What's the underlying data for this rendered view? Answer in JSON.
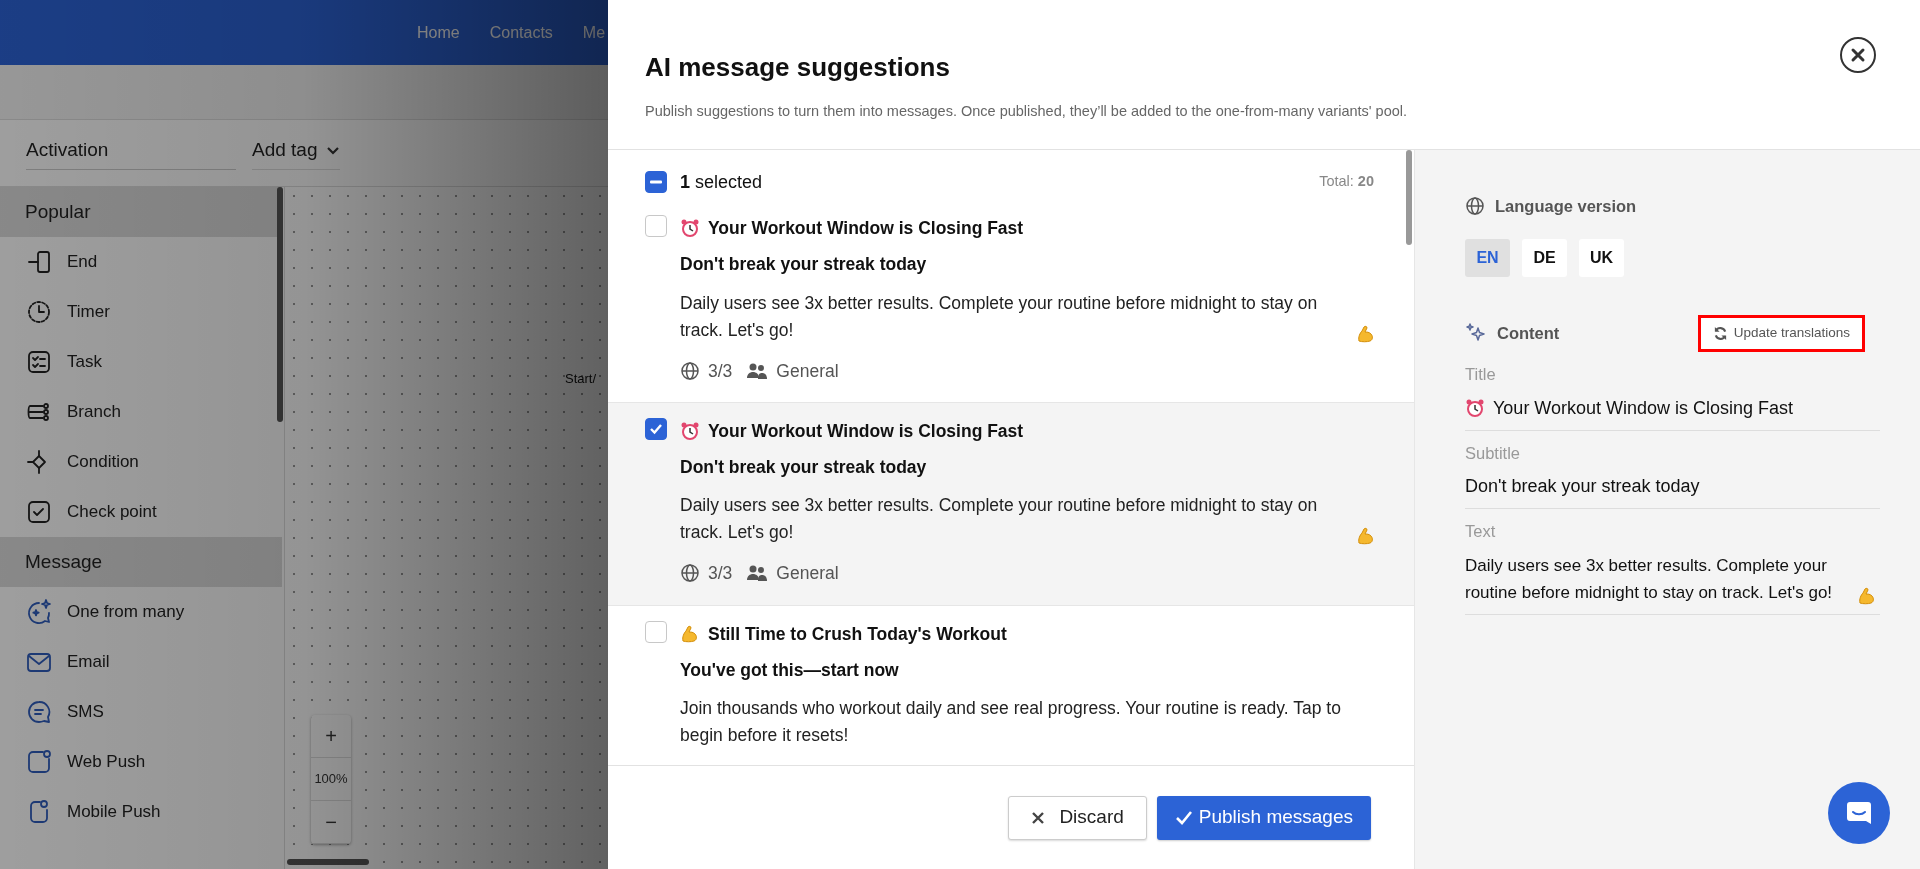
{
  "nav_links": [
    "Home",
    "Contacts",
    "Me"
  ],
  "toolbar": {
    "activation": "Activation",
    "add_tag": "Add tag"
  },
  "sidebar": [
    {
      "title": "Popular",
      "items": [
        "End",
        "Timer",
        "Task",
        "Branch",
        "Condition",
        "Check point"
      ]
    },
    {
      "title": "Message",
      "items": [
        "One from many",
        "Email",
        "SMS",
        "Web Push",
        "Mobile Push"
      ]
    }
  ],
  "canvas": {
    "node_label": "Start/",
    "zoom_in": "+",
    "zoom_level": "100%",
    "zoom_out": "−"
  },
  "modal": {
    "title": "AI message suggestions",
    "subtitle": "Publish suggestions to turn them into messages. Once published, they’ll be added to the one-from-many variants' pool.",
    "selection": {
      "indeterminate": true,
      "label": "**1** selected",
      "total": "Total: **20**"
    },
    "items": [
      {
        "kind": "alarm",
        "selected": false,
        "title": "Your Workout Window is Closing Fast",
        "subtitle": "Don't break your streak today",
        "text": "Daily users see 3x better results. Complete your routine before midnight to stay on track. Let's go!",
        "languages": "3/3",
        "segment": "General"
      },
      {
        "kind": "alarm",
        "selected": true,
        "title": "Your Workout Window is Closing Fast",
        "subtitle": "Don't break your streak today",
        "text": "Daily users see 3x better results. Complete your routine before midnight to stay on track. Let's go!",
        "languages": "3/3",
        "segment": "General"
      },
      {
        "kind": "flex",
        "selected": false,
        "title": "Still Time to Crush Today's Workout",
        "subtitle": "You've got this—start now",
        "text": "Join thousands who workout daily and see real progress. Your routine is ready. Tap to begin before it resets!"
      }
    ],
    "buttons": {
      "discard": "Discard",
      "publish": "Publish messages"
    },
    "panel": {
      "language_label": "Language version",
      "languages": [
        {
          "code": "EN",
          "selected": true
        },
        {
          "code": "DE",
          "selected": false
        },
        {
          "code": "UK",
          "selected": false
        }
      ],
      "content_label": "Content",
      "update_button": "Update translations",
      "fields": [
        {
          "kind": "title",
          "label": "Title",
          "value": "Your Workout Window is Closing Fast"
        },
        {
          "kind": "subtitle",
          "label": "Subtitle",
          "value": "Don't break your streak today"
        },
        {
          "kind": "text",
          "label": "Text",
          "value": "Daily users see 3x better results. Complete your routine before midnight to stay on track. Let's go!"
        }
      ]
    }
  }
}
